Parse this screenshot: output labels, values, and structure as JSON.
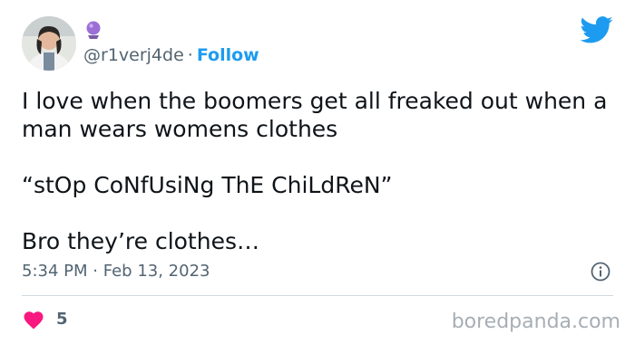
{
  "tweet": {
    "display_name_emoji": "crystal-ball-icon",
    "handle": "@r1verj4de",
    "separator": "·",
    "follow_label": "Follow",
    "text_lines": [
      "I love when the boomers get all freaked out when a man wears womens clothes",
      "“stOp CoNfUsiNg ThE ChiLdReN”",
      "Bro they’re clothes…"
    ],
    "time": "5:34 PM",
    "date_separator": "·",
    "date": "Feb 13, 2023",
    "likes": "5"
  },
  "icons": {
    "platform": "twitter-bird-icon",
    "info": "info-icon",
    "like": "heart-icon"
  },
  "colors": {
    "accent": "#1d9bf0",
    "heart": "#f91880",
    "secondary_text": "#536471"
  },
  "watermark": "boredpanda.com"
}
